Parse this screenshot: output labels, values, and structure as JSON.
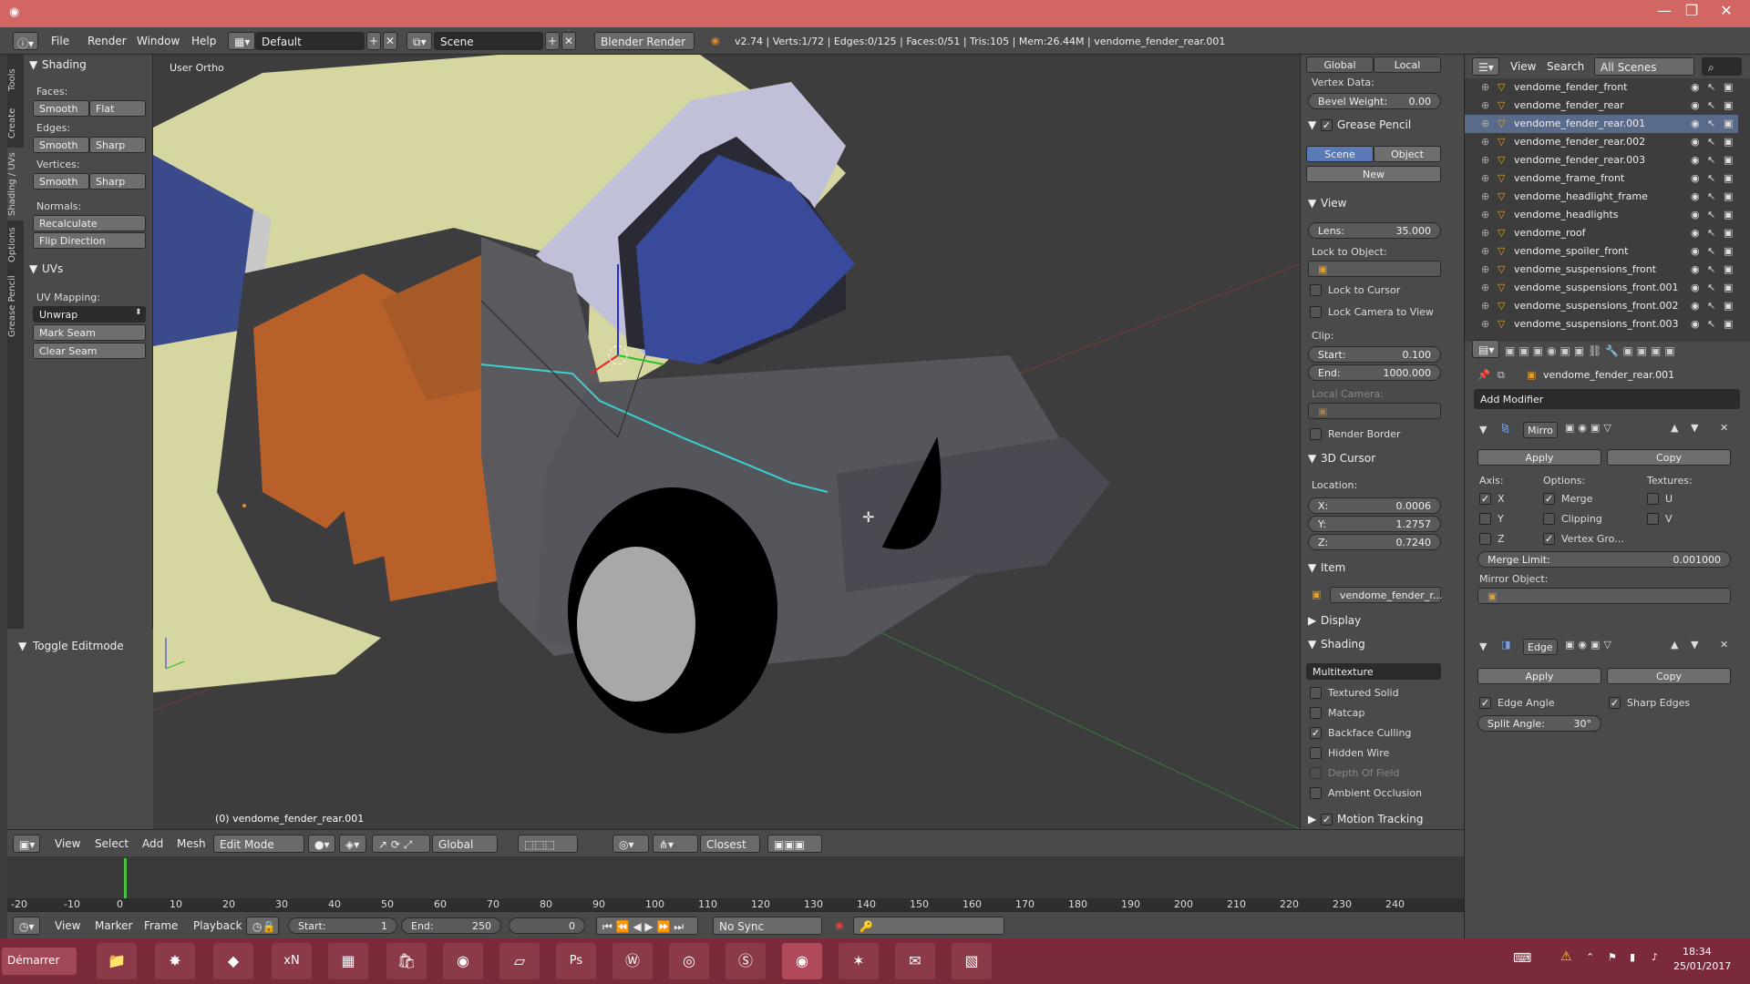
{
  "titlebar": {
    "minimize": "—",
    "maximize": "❐",
    "close": "✕"
  },
  "topbar": {
    "menus": [
      "File",
      "Render",
      "Window",
      "Help"
    ],
    "layout": "Default",
    "scene": "Scene",
    "engine": "Blender Render",
    "stats": "v2.74 | Verts:1/72 | Edges:0/125 | Faces:0/51 | Tris:105 | Mem:26.44M | vendome_fender_rear.001"
  },
  "tooltabs": [
    "Tools",
    "Create",
    "Shading / UVs",
    "Options",
    "Grease Pencil"
  ],
  "toolshelf": {
    "shading_title": "Shading",
    "faces_label": "Faces:",
    "faces_buttons": [
      "Smooth",
      "Flat"
    ],
    "edges_label": "Edges:",
    "edges_buttons": [
      "Smooth",
      "Sharp"
    ],
    "vertices_label": "Vertices:",
    "vertices_buttons": [
      "Smooth",
      "Sharp"
    ],
    "normals_label": "Normals:",
    "recalculate": "Recalculate",
    "flip_direction": "Flip Direction",
    "uvs_title": "UVs",
    "uv_mapping_label": "UV Mapping:",
    "unwrap": "Unwrap",
    "mark_seam": "Mark Seam",
    "clear_seam": "Clear Seam",
    "toggle_editmode": "Toggle Editmode"
  },
  "viewport": {
    "view_label": "User Ortho",
    "object_label": "(0) vendome_fender_rear.001",
    "colors": {
      "body_yellow": "#d6d6a0",
      "seat_orange": "#b8602a",
      "glass_blue": "#3a4a9a",
      "panel_grey": "#6a6a72",
      "edge_cyan": "#3ad0d0"
    }
  },
  "npanel": {
    "global": "Global",
    "local": "Local",
    "vertex_data": "Vertex Data:",
    "bevel_weight_label": "Bevel Weight:",
    "bevel_weight_value": "0.00",
    "grease_pencil": "Grease Pencil",
    "scene_btn": "Scene",
    "object_btn": "Object",
    "new_btn": "New",
    "view_title": "View",
    "lens_label": "Lens:",
    "lens_value": "35.000",
    "lock_to_object": "Lock to Object:",
    "lock_to_cursor": "Lock to Cursor",
    "lock_camera": "Lock Camera to View",
    "clip_label": "Clip:",
    "clip_start_label": "Start:",
    "clip_start_value": "0.100",
    "clip_end_label": "End:",
    "clip_end_value": "1000.000",
    "local_camera": "Local Camera:",
    "render_border": "Render Border",
    "cursor_title": "3D Cursor",
    "location_label": "Location:",
    "x_label": "X:",
    "x_value": "0.0006",
    "y_label": "Y:",
    "y_value": "1.2757",
    "z_label": "Z:",
    "z_value": "0.7240",
    "item_title": "Item",
    "item_name": "vendome_fender_r...",
    "display_title": "Display",
    "shading_title": "Shading",
    "shading_mode": "Multitexture",
    "textured_solid": "Textured Solid",
    "matcap": "Matcap",
    "backface_culling": "Backface Culling",
    "hidden_wire": "Hidden Wire",
    "depth_of_field": "Depth Of Field",
    "ambient_occlusion": "Ambient Occlusion",
    "motion_tracking": "Motion Tracking"
  },
  "vp_header": {
    "menus": [
      "View",
      "Select",
      "Add",
      "Mesh"
    ],
    "mode": "Edit Mode",
    "orientation": "Global",
    "snap": "Closest"
  },
  "timeline": {
    "ticks": [
      "-20",
      "-10",
      "0",
      "10",
      "20",
      "30",
      "40",
      "50",
      "60",
      "70",
      "80",
      "90",
      "100",
      "110",
      "120",
      "130",
      "140",
      "150",
      "160",
      "170",
      "180",
      "190",
      "200",
      "210",
      "220",
      "230",
      "240"
    ],
    "menus": [
      "View",
      "Marker",
      "Frame",
      "Playback"
    ],
    "start_label": "Start:",
    "start_value": "1",
    "end_label": "End:",
    "end_value": "250",
    "current": "0",
    "sync": "No Sync"
  },
  "outliner": {
    "menus": [
      "View",
      "Search"
    ],
    "scenes": "All Scenes",
    "items": [
      "vendome_fender_front",
      "vendome_fender_rear",
      "vendome_fender_rear.001",
      "vendome_fender_rear.002",
      "vendome_fender_rear.003",
      "vendome_frame_front",
      "vendome_headlight_frame",
      "vendome_headlights",
      "vendome_roof",
      "vendome_spoiler_front",
      "vendome_suspensions_front",
      "vendome_suspensions_front.001",
      "vendome_suspensions_front.002",
      "vendome_suspensions_front.003"
    ]
  },
  "properties": {
    "object_name": "vendome_fender_rear.001",
    "add_modifier": "Add Modifier",
    "mirror": {
      "name": "Mirro",
      "apply": "Apply",
      "copy": "Copy",
      "axis_label": "Axis:",
      "options_label": "Options:",
      "textures_label": "Textures:",
      "x": "X",
      "y": "Y",
      "z": "Z",
      "merge": "Merge",
      "clipping": "Clipping",
      "vertex_groups": "Vertex Gro...",
      "u": "U",
      "v": "V",
      "merge_limit_label": "Merge Limit:",
      "merge_limit_value": "0.001000",
      "mirror_object": "Mirror Object:"
    },
    "edge": {
      "name": "Edge",
      "apply": "Apply",
      "copy": "Copy",
      "edge_angle": "Edge Angle",
      "sharp_edges": "Sharp Edges",
      "split_angle_label": "Split Angle:",
      "split_angle_value": "30°"
    }
  },
  "taskbar": {
    "start": "Démarrer",
    "time": "18:34",
    "date": "25/01/2017"
  }
}
